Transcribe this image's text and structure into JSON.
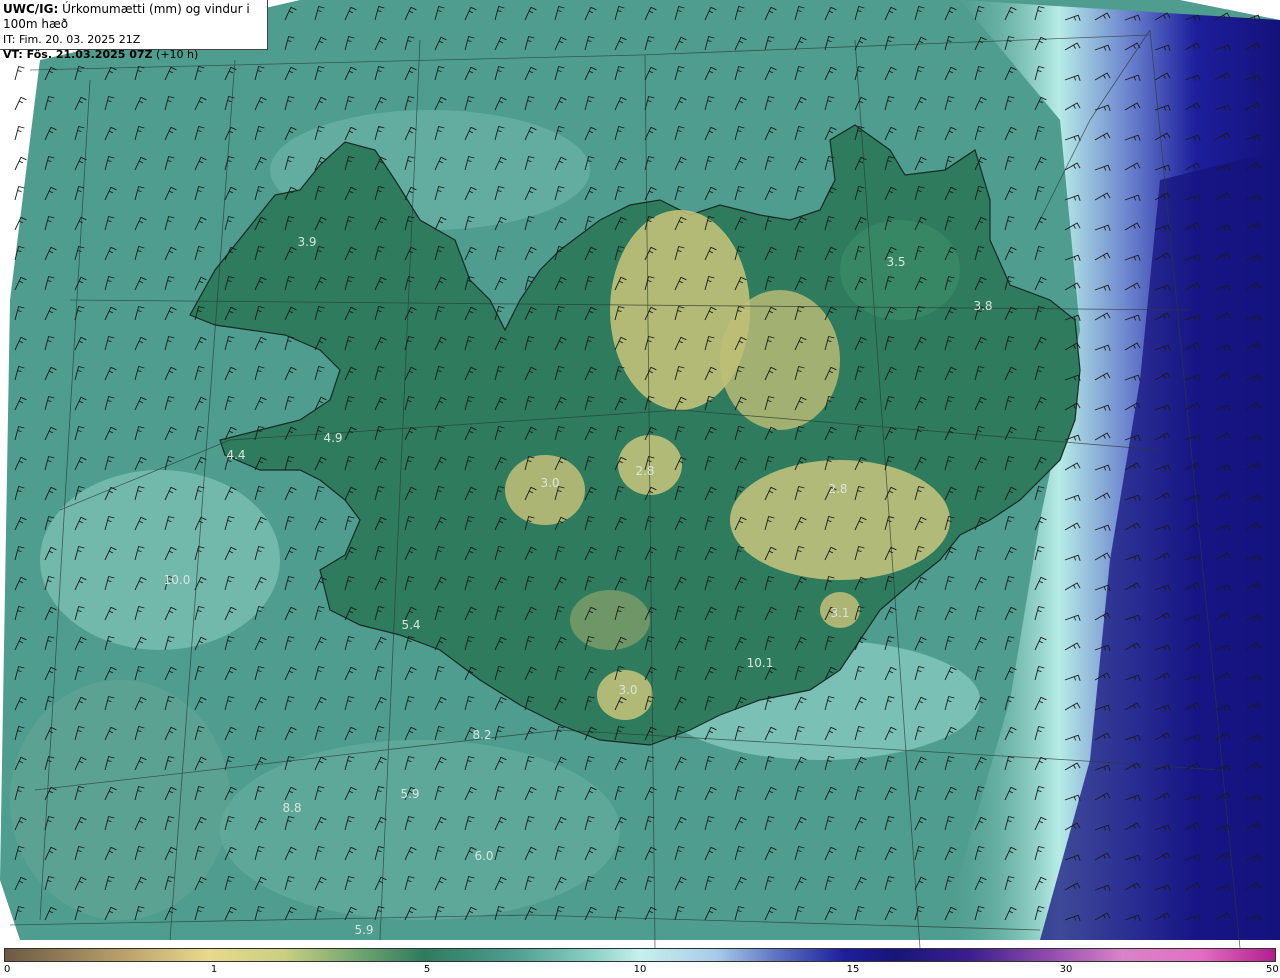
{
  "header": {
    "line1_bold": "UWC/IG:",
    "line1_rest": "Úrkomumætti (mm) og vindur i 100m hæð",
    "line2": "IT: Fim. 20. 03. 2025 21Z",
    "line3_bold": "VT: Fös. 21.03.2025 07Z",
    "line3_rest": "(+10 h)"
  },
  "map_values": [
    {
      "text": "3.9"
    },
    {
      "text": "4.9"
    },
    {
      "text": "4.4"
    },
    {
      "text": "3.0"
    },
    {
      "text": "2.8"
    },
    {
      "text": "3.5"
    },
    {
      "text": "3.8"
    },
    {
      "text": "5.4"
    },
    {
      "text": "3.0"
    },
    {
      "text": "5.9"
    },
    {
      "text": "6.0"
    },
    {
      "text": "5.9"
    },
    {
      "text": "3.1"
    },
    {
      "text": "10.0"
    },
    {
      "text": "10.1"
    },
    {
      "text": "8.2"
    },
    {
      "text": "8.8"
    },
    {
      "text": "2.8"
    }
  ],
  "colorbar": {
    "ticks": [
      "0",
      "1",
      "5",
      "10",
      "15",
      "30",
      "50"
    ]
  },
  "colors": {
    "sea_teal": "#4f9d8f",
    "land_green": "#2e7b5e",
    "highland_yellow": "#c9c57a",
    "heavy_blue": "#1a1a8c"
  }
}
